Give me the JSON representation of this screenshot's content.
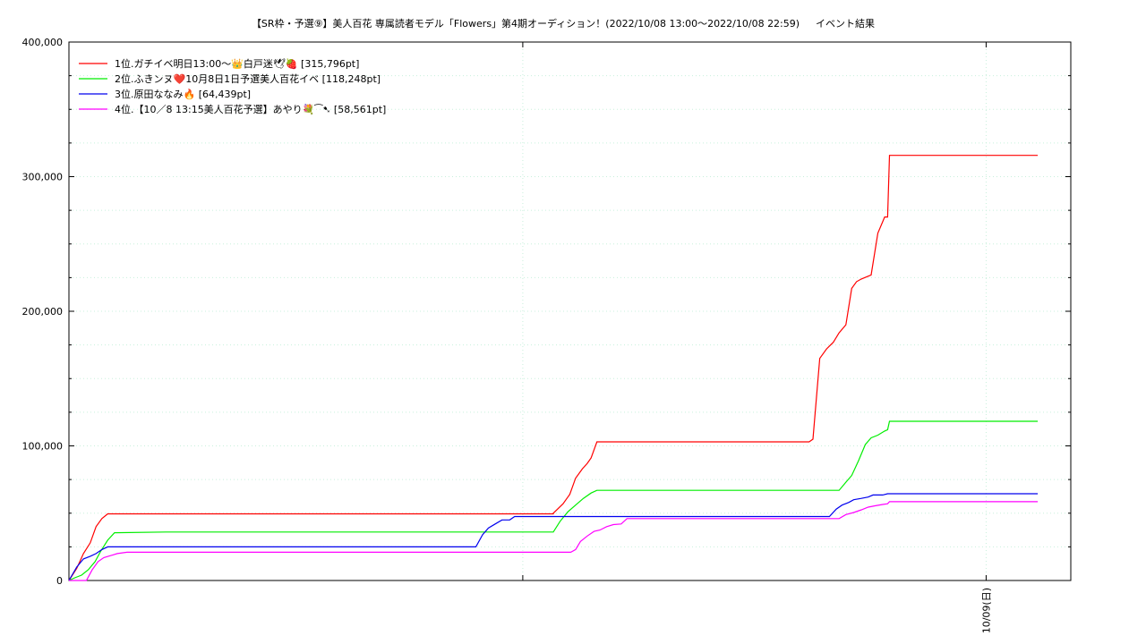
{
  "chart_data": {
    "type": "line",
    "title": "【SR枠・予選⑨】美人百花 専属読者モデル「Flowers」第4期オーディション！(2022/10/08 13:00〜2022/10/08 22:59)",
    "subtitle": "イベント結果",
    "xlabel": "",
    "ylabel": "",
    "ylim": [
      0,
      400000
    ],
    "yticks": [
      0,
      100000,
      200000,
      300000,
      400000
    ],
    "ytick_labels": [
      "0",
      "100,000",
      "200,000",
      "300,000",
      "400,000"
    ],
    "xlim": [
      0,
      1
    ],
    "xticks": [
      0.453,
      0.9155
    ],
    "xtick_labels": [
      "",
      "10/09(日)"
    ],
    "grid": true,
    "legend_position": "top-left",
    "series": [
      {
        "name": "1位.ガチイベ明日13:00〜👑白戸迷🕊🍓 [315,796pt]",
        "color": "#ff0000",
        "points": [
          [
            0,
            0
          ],
          [
            0.008,
            9000
          ],
          [
            0.015,
            20000
          ],
          [
            0.022,
            28000
          ],
          [
            0.028,
            40000
          ],
          [
            0.034,
            46000
          ],
          [
            0.04,
            49500
          ],
          [
            0.05,
            49500
          ],
          [
            0.2,
            49500
          ],
          [
            0.4,
            49500
          ],
          [
            0.5,
            49500
          ],
          [
            0.5,
            50000
          ],
          [
            0.51,
            57000
          ],
          [
            0.517,
            64000
          ],
          [
            0.523,
            76000
          ],
          [
            0.53,
            83000
          ],
          [
            0.535,
            87000
          ],
          [
            0.539,
            91000
          ],
          [
            0.545,
            103000
          ],
          [
            0.6,
            103000
          ],
          [
            0.7,
            103000
          ],
          [
            0.764,
            103000
          ],
          [
            0.768,
            105000
          ],
          [
            0.775,
            165000
          ],
          [
            0.782,
            172000
          ],
          [
            0.789,
            177000
          ],
          [
            0.795,
            184000
          ],
          [
            0.802,
            190000
          ],
          [
            0.808,
            217000
          ],
          [
            0.813,
            222000
          ],
          [
            0.818,
            224000
          ],
          [
            0.828,
            227000
          ],
          [
            0.835,
            258000
          ],
          [
            0.842,
            270000
          ],
          [
            0.845,
            270000
          ],
          [
            0.847,
            315796
          ],
          [
            0.9,
            315796
          ],
          [
            1,
            315796
          ]
        ]
      },
      {
        "name": "2位.ふきンヌ❤️10月8日1日予選美人百花イベ [118,248pt]",
        "color": "#00ee00",
        "points": [
          [
            0,
            0
          ],
          [
            0.006,
            2000
          ],
          [
            0.013,
            4000
          ],
          [
            0.02,
            8000
          ],
          [
            0.027,
            14000
          ],
          [
            0.033,
            22000
          ],
          [
            0.04,
            30000
          ],
          [
            0.047,
            35500
          ],
          [
            0.1,
            36000
          ],
          [
            0.3,
            36000
          ],
          [
            0.45,
            36000
          ],
          [
            0.5,
            36000
          ],
          [
            0.507,
            44000
          ],
          [
            0.515,
            51000
          ],
          [
            0.523,
            56000
          ],
          [
            0.531,
            61000
          ],
          [
            0.539,
            65000
          ],
          [
            0.545,
            67000
          ],
          [
            0.6,
            67000
          ],
          [
            0.7,
            67000
          ],
          [
            0.795,
            67000
          ],
          [
            0.802,
            73000
          ],
          [
            0.808,
            78000
          ],
          [
            0.815,
            89000
          ],
          [
            0.822,
            101000
          ],
          [
            0.828,
            106000
          ],
          [
            0.835,
            108000
          ],
          [
            0.842,
            111000
          ],
          [
            0.845,
            112000
          ],
          [
            0.847,
            118248
          ],
          [
            0.9,
            118248
          ],
          [
            1,
            118248
          ]
        ]
      },
      {
        "name": "3位.原田ななみ🔥 [64,439pt]",
        "color": "#0000ee",
        "points": [
          [
            0,
            0
          ],
          [
            0.008,
            10000
          ],
          [
            0.015,
            16000
          ],
          [
            0.022,
            18000
          ],
          [
            0.028,
            20000
          ],
          [
            0.034,
            23000
          ],
          [
            0.04,
            25000
          ],
          [
            0.06,
            25000
          ],
          [
            0.3,
            25000
          ],
          [
            0.42,
            25000
          ],
          [
            0.427,
            34000
          ],
          [
            0.433,
            39000
          ],
          [
            0.44,
            42000
          ],
          [
            0.447,
            45000
          ],
          [
            0.455,
            45000
          ],
          [
            0.46,
            47500
          ],
          [
            0.5,
            47500
          ],
          [
            0.6,
            47500
          ],
          [
            0.7,
            47500
          ],
          [
            0.77,
            47500
          ],
          [
            0.785,
            47500
          ],
          [
            0.792,
            53000
          ],
          [
            0.798,
            56000
          ],
          [
            0.805,
            58000
          ],
          [
            0.81,
            60000
          ],
          [
            0.818,
            61000
          ],
          [
            0.825,
            62000
          ],
          [
            0.83,
            63500
          ],
          [
            0.84,
            63500
          ],
          [
            0.845,
            64439
          ],
          [
            0.9,
            64439
          ],
          [
            1,
            64439
          ]
        ]
      },
      {
        "name": "4位.【10／8 13:15美人百花予選】あやり💐⁀➷ [58,561pt]",
        "color": "#ff00ff",
        "points": [
          [
            0,
            0
          ],
          [
            0.018,
            0
          ],
          [
            0.024,
            8000
          ],
          [
            0.03,
            14000
          ],
          [
            0.036,
            17000
          ],
          [
            0.043,
            18500
          ],
          [
            0.05,
            20000
          ],
          [
            0.06,
            21000
          ],
          [
            0.1,
            21000
          ],
          [
            0.3,
            21000
          ],
          [
            0.5,
            21000
          ],
          [
            0.518,
            21000
          ],
          [
            0.523,
            23000
          ],
          [
            0.528,
            29000
          ],
          [
            0.535,
            33000
          ],
          [
            0.542,
            36500
          ],
          [
            0.548,
            37500
          ],
          [
            0.555,
            40000
          ],
          [
            0.562,
            41500
          ],
          [
            0.57,
            42000
          ],
          [
            0.576,
            46000
          ],
          [
            0.6,
            46000
          ],
          [
            0.7,
            46000
          ],
          [
            0.795,
            46000
          ],
          [
            0.802,
            49000
          ],
          [
            0.81,
            50500
          ],
          [
            0.818,
            52500
          ],
          [
            0.825,
            54500
          ],
          [
            0.832,
            55500
          ],
          [
            0.84,
            56500
          ],
          [
            0.845,
            57000
          ],
          [
            0.847,
            58561
          ],
          [
            0.9,
            58561
          ],
          [
            1,
            58561
          ]
        ]
      }
    ]
  }
}
